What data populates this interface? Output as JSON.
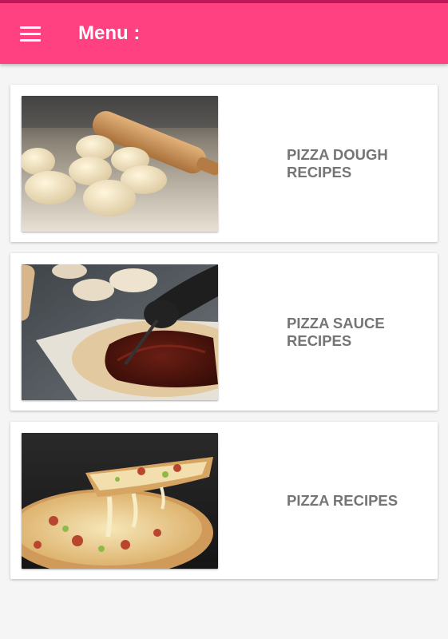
{
  "app_bar": {
    "title": "Menu :",
    "color": "#ff4081",
    "menu_icon": "hamburger-menu-icon"
  },
  "menu_items": [
    {
      "label": "PIZZA DOUGH RECIPES",
      "image": "pizza-dough-balls-photo"
    },
    {
      "label": "PIZZA SAUCE RECIPES",
      "image": "pizza-sauce-spreading-photo"
    },
    {
      "label": "PIZZA RECIPES",
      "image": "pizza-slice-cheese-pull-photo"
    }
  ]
}
